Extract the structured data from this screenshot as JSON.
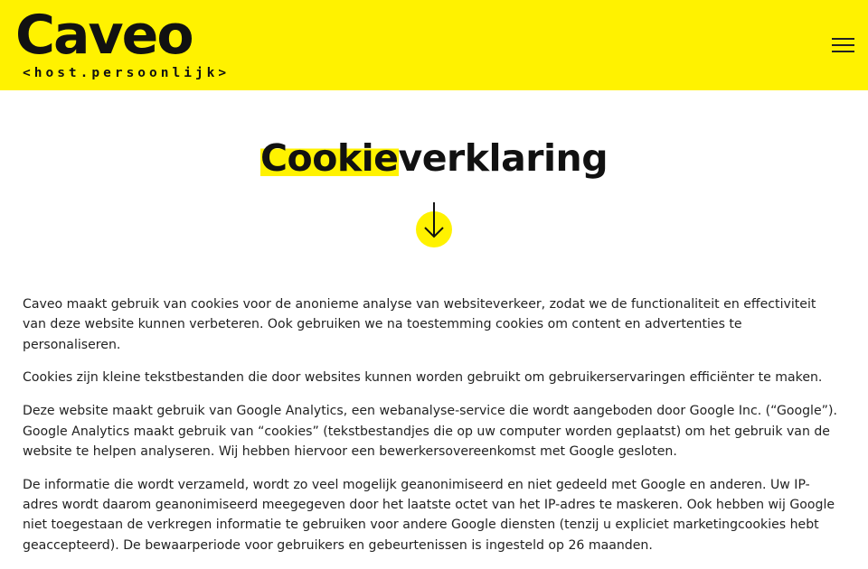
{
  "header": {
    "logo_word": "Caveo",
    "logo_tagline": "<host.persoonlijk>",
    "menu_icon": "hamburger-menu-icon",
    "background_color": "#fff200"
  },
  "hero": {
    "title_highlight": "Cookie",
    "title_rest": "verklaring",
    "arrow_icon": "arrow-down-icon",
    "highlight_color": "#fff200"
  },
  "content": {
    "paragraphs": [
      "Caveo maakt gebruik van cookies voor de anonieme analyse van websiteverkeer, zodat we de functionaliteit en effectiviteit van deze website kunnen verbeteren. Ook gebruiken we na toestemming cookies om content en advertenties te personaliseren.",
      "Cookies zijn kleine tekstbestanden die door websites kunnen worden gebruikt om gebruikerservaringen efficiënter te maken.",
      "Deze website maakt gebruik van Google Analytics, een webanalyse-service die wordt aangeboden door Google Inc. (“Google”). Google Analytics maakt gebruik van “cookies” (tekstbestandjes die op uw computer worden geplaatst) om het gebruik van de website te helpen analyseren. Wij hebben hiervoor een bewerkersovereenkomst met Google gesloten.",
      "De informatie die wordt verzameld, wordt zo veel mogelijk geanonimiseerd en niet gedeeld met Google en anderen. Uw IP-adres wordt daarom geanonimiseerd meegegeven door het laatste octet van het IP-adres te maskeren. Ook hebben wij Google niet toegestaan de verkregen informatie te gebruiken voor andere Google diensten (tenzij u expliciet marketingcookies hebt geaccepteerd). De bewaarperiode voor gebruikers en gebeurtenissen is ingesteld op 26 maanden."
    ]
  }
}
